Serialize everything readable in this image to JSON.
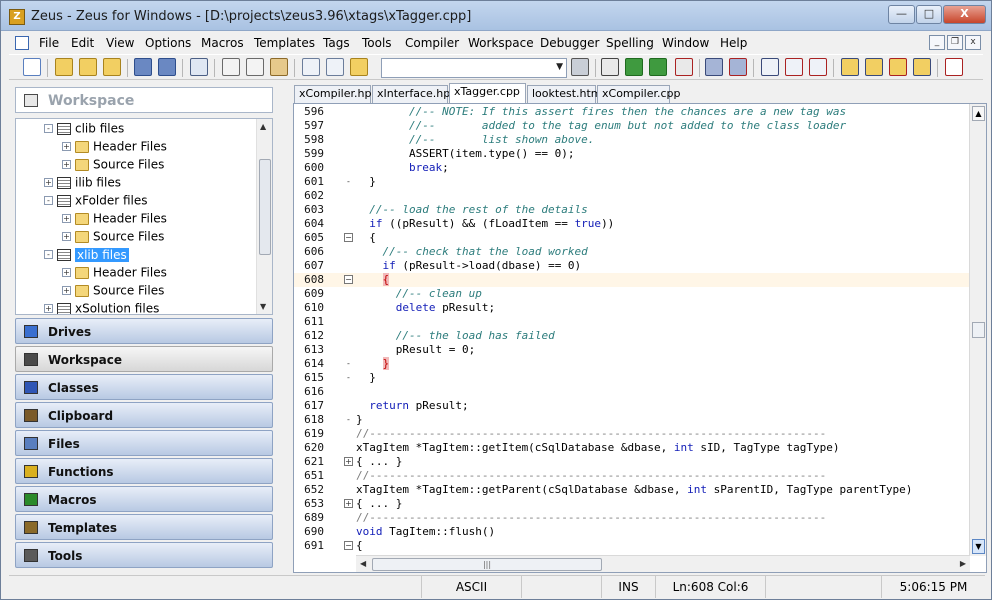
{
  "window": {
    "title": "Zeus - Zeus for Windows - [D:\\projects\\zeus3.96\\xtags\\xTagger.cpp]",
    "app_icon": "Z",
    "controls": {
      "minimize": "—",
      "maximize": "□",
      "close": "X"
    }
  },
  "menu": {
    "items": [
      "File",
      "Edit",
      "View",
      "Options",
      "Macros",
      "Templates",
      "Tags",
      "Tools",
      "Compiler",
      "Workspace",
      "Debugger",
      "Spelling",
      "Window",
      "Help"
    ],
    "mdi_controls": [
      "_",
      "❐",
      "x"
    ]
  },
  "toolbar": {
    "combo_value": "",
    "combo_arrow": "▼"
  },
  "workspace": {
    "header": "Workspace",
    "tree": [
      {
        "label": "clib files",
        "type": "proj",
        "toggle": "-",
        "level": 1
      },
      {
        "label": "Header Files",
        "type": "folder",
        "toggle": "+",
        "level": 2
      },
      {
        "label": "Source Files",
        "type": "folder",
        "toggle": "+",
        "level": 2
      },
      {
        "label": "ilib files",
        "type": "proj",
        "toggle": "+",
        "level": 1
      },
      {
        "label": "xFolder files",
        "type": "proj",
        "toggle": "-",
        "level": 1
      },
      {
        "label": "Header Files",
        "type": "folder",
        "toggle": "+",
        "level": 2
      },
      {
        "label": "Source Files",
        "type": "folder",
        "toggle": "+",
        "level": 2
      },
      {
        "label": "xlib files",
        "type": "proj",
        "toggle": "-",
        "level": 1,
        "selected": true
      },
      {
        "label": "Header Files",
        "type": "folder",
        "toggle": "+",
        "level": 2
      },
      {
        "label": "Source Files",
        "type": "folder",
        "toggle": "+",
        "level": 2
      },
      {
        "label": "xSolution files",
        "type": "proj",
        "toggle": "+",
        "level": 1
      }
    ],
    "sections": [
      {
        "label": "Drives",
        "icon": "drives-icon"
      },
      {
        "label": "Workspace",
        "icon": "workspace-icon",
        "active": true
      },
      {
        "label": "Classes",
        "icon": "classes-icon"
      },
      {
        "label": "Clipboard",
        "icon": "clipboard-icon"
      },
      {
        "label": "Files",
        "icon": "files-icon"
      },
      {
        "label": "Functions",
        "icon": "functions-icon"
      },
      {
        "label": "Macros",
        "icon": "macros-icon"
      },
      {
        "label": "Templates",
        "icon": "templates-icon"
      },
      {
        "label": "Tools",
        "icon": "tools-icon"
      }
    ]
  },
  "tabs": [
    {
      "label": "xCompiler.hpp"
    },
    {
      "label": "xInterface.hpp"
    },
    {
      "label": "xTagger.cpp",
      "active": true
    },
    {
      "label": "looktest.html"
    },
    {
      "label": "xCompiler.cpp"
    }
  ],
  "code_lines": [
    {
      "n": "596",
      "fold": "",
      "html": "        <span class=\"cm\">//-- NOTE: If this assert fires then the chances are a new tag was</span>"
    },
    {
      "n": "597",
      "fold": "",
      "html": "        <span class=\"cm\">//--       added to the tag enum but not added to the class loader</span>"
    },
    {
      "n": "598",
      "fold": "",
      "html": "        <span class=\"cm\">//--       list shown above.</span>"
    },
    {
      "n": "599",
      "fold": "",
      "html": "        ASSERT(item.type() == 0);"
    },
    {
      "n": "600",
      "fold": "",
      "html": "        <span class=\"kw\">break</span>;"
    },
    {
      "n": "601",
      "fold": "-",
      "html": "  }"
    },
    {
      "n": "602",
      "fold": "",
      "html": ""
    },
    {
      "n": "603",
      "fold": "",
      "html": "  <span class=\"cm\">//-- load the rest of the details</span>"
    },
    {
      "n": "604",
      "fold": "",
      "html": "  <span class=\"kw\">if</span> ((pResult) &amp;&amp; (fLoadItem == <span class=\"kw\">true</span>))"
    },
    {
      "n": "605",
      "fold": "box",
      "html": "  {"
    },
    {
      "n": "606",
      "fold": "",
      "html": "    <span class=\"cm\">//-- check that the load worked</span>"
    },
    {
      "n": "607",
      "fold": "",
      "html": "    <span class=\"kw\">if</span> (pResult-&gt;load(dbase) == 0)"
    },
    {
      "n": "608",
      "fold": "box",
      "html": "    <span class=\"brace-hl\">{</span>",
      "current": true
    },
    {
      "n": "609",
      "fold": "",
      "html": "      <span class=\"cm\">//-- clean up</span>"
    },
    {
      "n": "610",
      "fold": "",
      "html": "      <span class=\"kw\">delete</span> pResult;"
    },
    {
      "n": "611",
      "fold": "",
      "html": ""
    },
    {
      "n": "612",
      "fold": "",
      "html": "      <span class=\"cm\">//-- the load has failed</span>"
    },
    {
      "n": "613",
      "fold": "",
      "html": "      pResult = 0;"
    },
    {
      "n": "614",
      "fold": "-",
      "html": "    <span class=\"brace-hl\">}</span>"
    },
    {
      "n": "615",
      "fold": "-",
      "html": "  }"
    },
    {
      "n": "616",
      "fold": "",
      "html": ""
    },
    {
      "n": "617",
      "fold": "",
      "html": "  <span class=\"kw\">return</span> pResult;"
    },
    {
      "n": "618",
      "fold": "-",
      "html": "}"
    },
    {
      "n": "619",
      "fold": "",
      "html": "<span class=\"sep\">//---------------------------------------------------------------------</span>"
    },
    {
      "n": "620",
      "fold": "",
      "html": "xTagItem *TagItem::getItem(cSqlDatabase &amp;dbase, <span class=\"kw\">int</span> sID, TagType tagType)"
    },
    {
      "n": "621",
      "fold": "plus",
      "html": "{ ... }"
    },
    {
      "n": "651",
      "fold": "",
      "html": "<span class=\"sep\">//---------------------------------------------------------------------</span>"
    },
    {
      "n": "652",
      "fold": "",
      "html": "xTagItem *TagItem::getParent(cSqlDatabase &amp;dbase, <span class=\"kw\">int</span> sParentID, TagType parentType)"
    },
    {
      "n": "653",
      "fold": "plus",
      "html": "{ ... }"
    },
    {
      "n": "689",
      "fold": "",
      "html": "<span class=\"sep\">//---------------------------------------------------------------------</span>"
    },
    {
      "n": "690",
      "fold": "",
      "html": "<span class=\"kw\">void</span> TagItem::flush()"
    },
    {
      "n": "691",
      "fold": "box",
      "html": "{"
    }
  ],
  "status": {
    "encoding": "ASCII",
    "mode": "INS",
    "position": "Ln:608 Col:6",
    "time": "5:06:15 PM"
  }
}
